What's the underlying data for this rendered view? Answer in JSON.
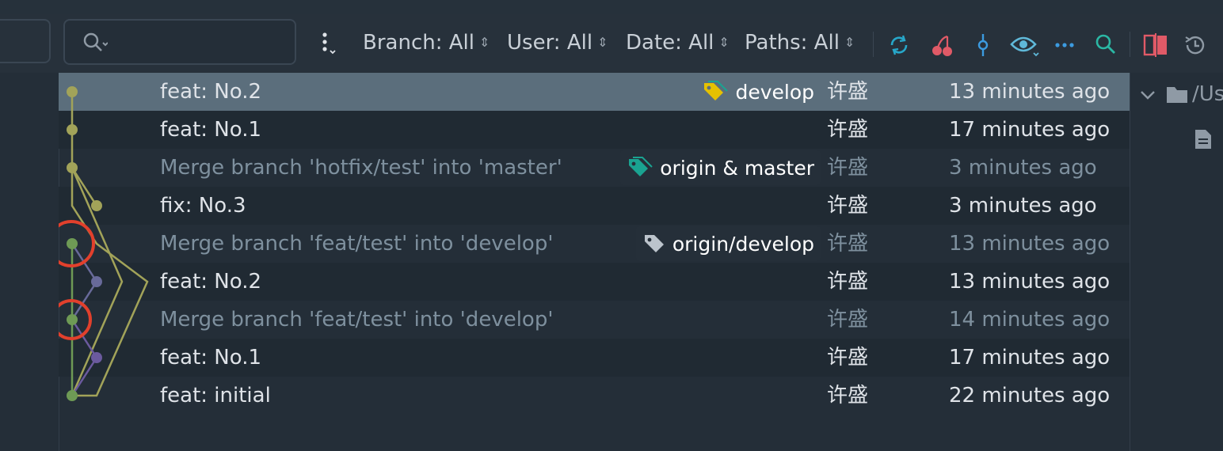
{
  "toolbar": {
    "search": {
      "value": "",
      "placeholder": ""
    },
    "filters": {
      "branch": "Branch: All",
      "user": "User: All",
      "date": "Date: All",
      "paths": "Paths: All"
    },
    "icons": [
      "more-vertical-icon",
      "refresh-icon",
      "cherry-pick-icon",
      "commit-icon",
      "eye-icon",
      "more-horizontal-icon",
      "search-icon",
      "diff-icon",
      "history-icon"
    ]
  },
  "commits": [
    {
      "message": "feat: No.2",
      "ref": "develop",
      "ref_color": "#e5c100",
      "author": "许盛",
      "date": "13 minutes ago",
      "dimmed": false,
      "selected": true
    },
    {
      "message": "feat: No.1",
      "ref": "",
      "author": "许盛",
      "date": "17 minutes ago",
      "dimmed": false
    },
    {
      "message": "Merge branch 'hotfix/test' into 'master'",
      "ref": "origin & master",
      "ref_color": "#1aa391",
      "author": "许盛",
      "date": "3 minutes ago",
      "dimmed": true
    },
    {
      "message": "fix: No.3",
      "ref": "",
      "author": "许盛",
      "date": "3 minutes ago",
      "dimmed": false
    },
    {
      "message": "Merge branch 'feat/test' into 'develop'",
      "ref": "origin/develop",
      "ref_color": "#bcc4cc",
      "author": "许盛",
      "date": "13 minutes ago",
      "dimmed": true
    },
    {
      "message": "feat: No.2",
      "ref": "",
      "author": "许盛",
      "date": "13 minutes ago",
      "dimmed": false
    },
    {
      "message": "Merge branch 'feat/test' into 'develop'",
      "ref": "",
      "author": "许盛",
      "date": "14 minutes ago",
      "dimmed": true
    },
    {
      "message": "feat: No.1",
      "ref": "",
      "author": "许盛",
      "date": "17 minutes ago",
      "dimmed": false
    },
    {
      "message": "feat: initial",
      "ref": "",
      "author": "许盛",
      "date": "22 minutes ago",
      "dimmed": false
    }
  ],
  "graph_colors": {
    "olive": "#a2a359",
    "green": "#6e9a55",
    "purple": "#6b5a9e",
    "slate": "#686a9a",
    "highlight": "#e2402c"
  },
  "details": {
    "path_prefix": "/Us"
  }
}
